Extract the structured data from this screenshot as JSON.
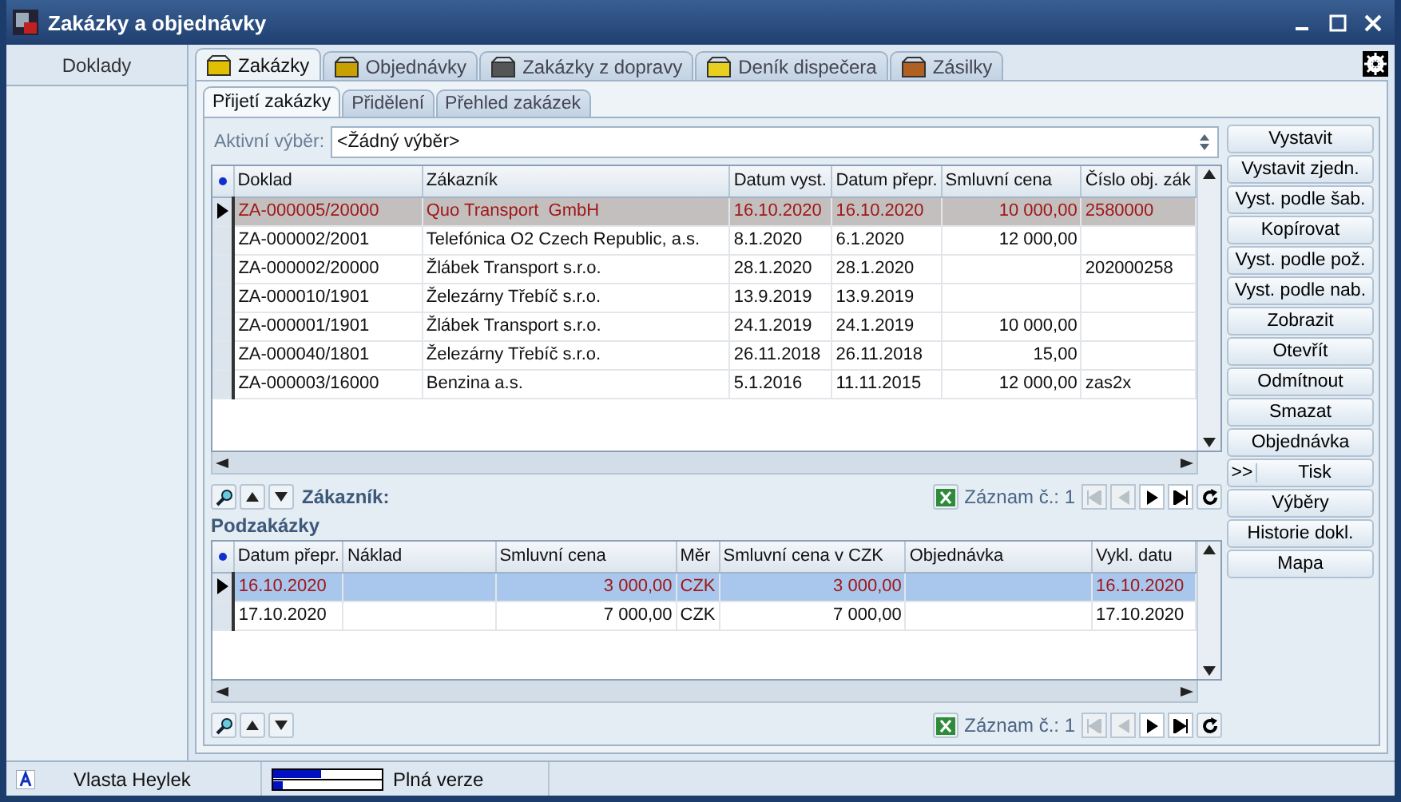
{
  "window": {
    "title": "Zakázky a objednávky"
  },
  "sidebar": {
    "header": "Doklady"
  },
  "tabs": [
    {
      "label": "Zakázky",
      "selected": true
    },
    {
      "label": "Objednávky",
      "selected": false
    },
    {
      "label": "Zakázky z dopravy",
      "selected": false
    },
    {
      "label": "Deník dispečera",
      "selected": false
    },
    {
      "label": "Zásilky",
      "selected": false
    }
  ],
  "subtabs": [
    {
      "label": "Přijetí zakázky",
      "selected": true
    },
    {
      "label": "Přidělení",
      "selected": false
    },
    {
      "label": "Přehled zakázek",
      "selected": false
    }
  ],
  "filter": {
    "label": "Aktivní výběr:",
    "value": "<Žádný výběr>"
  },
  "orders": {
    "columns": [
      {
        "label": "Doklad",
        "kind": "text"
      },
      {
        "label": "Zákazník",
        "kind": "text"
      },
      {
        "label": "Datum vyst.",
        "kind": "text"
      },
      {
        "label": "Datum přepr.",
        "kind": "text"
      },
      {
        "label": "Smluvní cena",
        "kind": "number"
      },
      {
        "label": "Číslo obj. zák",
        "kind": "text"
      }
    ],
    "rows": [
      {
        "selected": true,
        "cells": [
          "ZA-000005/20000",
          "Quo Transport  GmbH",
          "16.10.2020",
          "16.10.2020",
          "10 000,00",
          "2580000"
        ]
      },
      {
        "selected": false,
        "cells": [
          "ZA-000002/2001",
          "Telefónica O2 Czech Republic, a.s.",
          "8.1.2020",
          "6.1.2020",
          "12 000,00",
          null
        ]
      },
      {
        "selected": false,
        "cells": [
          "ZA-000002/20000",
          "Žlábek Transport s.r.o.",
          "28.1.2020",
          "28.1.2020",
          null,
          "202000258"
        ]
      },
      {
        "selected": false,
        "cells": [
          "ZA-000010/1901",
          "Železárny Třebíč s.r.o.",
          "13.9.2019",
          "13.9.2019",
          null,
          null
        ]
      },
      {
        "selected": false,
        "cells": [
          "ZA-000001/1901",
          "Žlábek Transport s.r.o.",
          "24.1.2019",
          "24.1.2019",
          "10 000,00",
          null
        ]
      },
      {
        "selected": false,
        "cells": [
          "ZA-000040/1801",
          "Železárny Třebíč s.r.o.",
          "26.11.2018",
          "26.11.2018",
          "15,00",
          null
        ]
      },
      {
        "selected": false,
        "cells": [
          "ZA-000003/16000",
          "Benzina a.s.",
          "5.1.2016",
          "11.11.2015",
          "12 000,00",
          "zas2x"
        ]
      }
    ]
  },
  "orders_toolbar": {
    "label": "Zákazník:",
    "record": "Záznam č.: 1",
    "nav": [
      {
        "kind": "first",
        "disabled": true
      },
      {
        "kind": "prev",
        "disabled": true
      },
      {
        "kind": "next",
        "disabled": false
      },
      {
        "kind": "last",
        "disabled": false
      }
    ]
  },
  "subgrid_title": "Podzakázky",
  "suborders": {
    "columns": [
      {
        "label": "Datum přepr.",
        "kind": "text"
      },
      {
        "label": "Náklad",
        "kind": "text"
      },
      {
        "label": "Smluvní cena",
        "kind": "number"
      },
      {
        "label": "Měr",
        "kind": "text"
      },
      {
        "label": "Smluvní cena v CZK",
        "kind": "number"
      },
      {
        "label": "Objednávka",
        "kind": "text"
      },
      {
        "label": "Vykl. datu",
        "kind": "text"
      }
    ],
    "rows": [
      {
        "selected": true,
        "cells": [
          "16.10.2020",
          null,
          "3 000,00",
          "CZK",
          "3 000,00",
          null,
          "16.10.2020"
        ]
      },
      {
        "selected": false,
        "cells": [
          "17.10.2020",
          null,
          "7 000,00",
          "CZK",
          "7 000,00",
          null,
          "17.10.2020"
        ]
      }
    ]
  },
  "suborders_toolbar": {
    "record": "Záznam č.: 1",
    "nav": [
      {
        "kind": "first",
        "disabled": true
      },
      {
        "kind": "prev",
        "disabled": true
      },
      {
        "kind": "next",
        "disabled": false
      },
      {
        "kind": "last",
        "disabled": false
      }
    ]
  },
  "actions": [
    {
      "label": "Vystavit"
    },
    {
      "label": "Vystavit zjedn."
    },
    {
      "label": "Vyst. podle šab."
    },
    {
      "label": "Kopírovat"
    },
    {
      "label": "Vyst. podle pož."
    },
    {
      "label": "Vyst. podle nab."
    },
    {
      "label": "Zobrazit"
    },
    {
      "label": "Otevřít"
    },
    {
      "label": "Odmítnout"
    },
    {
      "label": "Smazat"
    },
    {
      "label": "Objednávka"
    },
    {
      "label": "Tisk",
      "prefix": ">>"
    },
    {
      "label": "Výběry"
    },
    {
      "label": "Historie dokl."
    },
    {
      "label": "Mapa"
    }
  ],
  "status_bar": {
    "user": "Vlasta Heylek",
    "edition": "Plná verze"
  }
}
